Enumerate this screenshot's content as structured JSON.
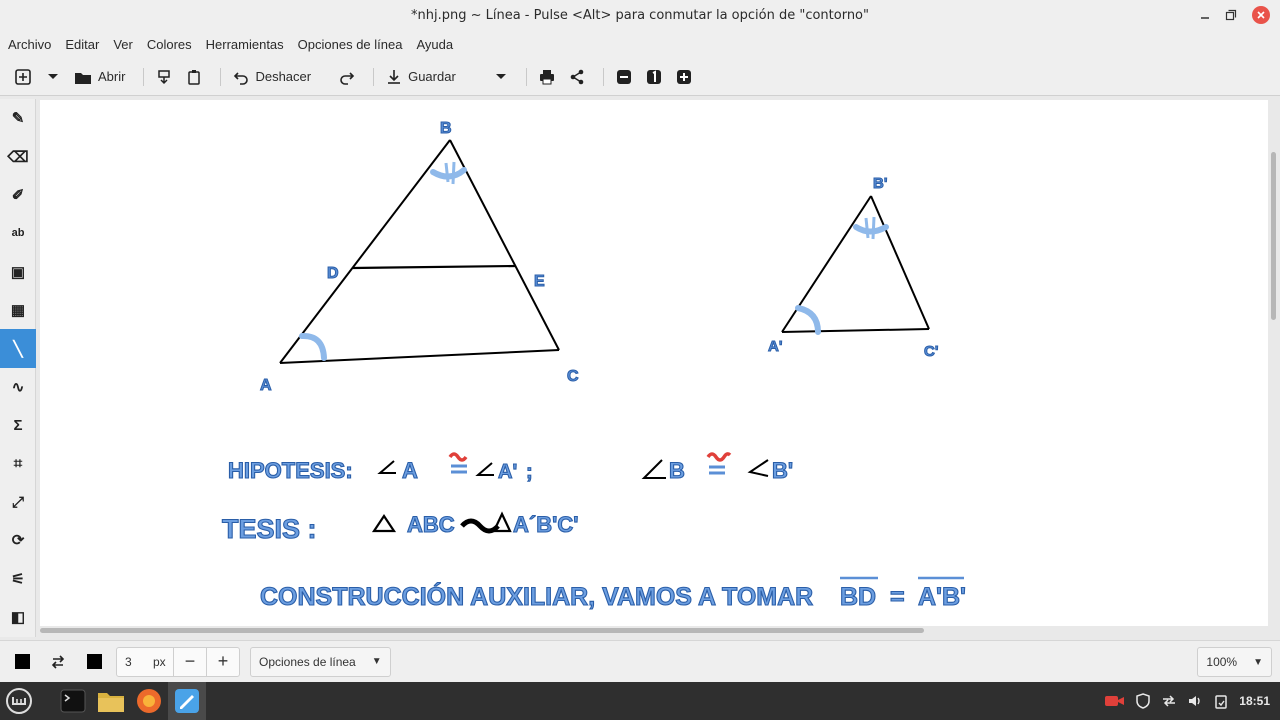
{
  "window": {
    "title": "*nhj.png ~ Línea - Pulse <Alt> para conmutar la opción de \"contorno\""
  },
  "menubar": {
    "items": [
      "Archivo",
      "Editar",
      "Ver",
      "Colores",
      "Herramientas",
      "Opciones de línea",
      "Ayuda"
    ]
  },
  "toolbar": {
    "open_label": "Abrir",
    "undo_label": "Deshacer",
    "save_label": "Guardar"
  },
  "palette": {
    "tools": [
      {
        "name": "pencil-tool-icon",
        "glyph": "✎"
      },
      {
        "name": "eraser-tool-icon",
        "glyph": "⌫"
      },
      {
        "name": "brush-tool-icon",
        "glyph": "✐"
      },
      {
        "name": "text-tool-icon",
        "glyph": "ab"
      },
      {
        "name": "rectangle-tool-icon",
        "glyph": "▣"
      },
      {
        "name": "selection-tool-icon",
        "glyph": "▦"
      },
      {
        "name": "line-tool-icon",
        "glyph": "╲",
        "active": true
      },
      {
        "name": "curve-tool-icon",
        "glyph": "∿"
      },
      {
        "name": "freeshape-tool-icon",
        "glyph": "Σ"
      },
      {
        "name": "crop-tool-icon",
        "glyph": "⌗"
      },
      {
        "name": "scale-tool-icon",
        "glyph": "⤢"
      },
      {
        "name": "rotate-tool-icon",
        "glyph": "⟳"
      },
      {
        "name": "filters-tool-icon",
        "glyph": "⚟"
      },
      {
        "name": "colors-tool-icon",
        "glyph": "◧"
      }
    ]
  },
  "canvas": {
    "labels": {
      "B": "B",
      "D": "D",
      "E": "E",
      "A": "A",
      "C": "C",
      "Bp": "B'",
      "Ap": "A'",
      "Cp": "C'"
    },
    "hipotesis": {
      "title": "HIPOTESIS:",
      "a1": "A",
      "a2": "A'",
      "sep": ";",
      "b1": "B",
      "b2": "B'"
    },
    "tesis": {
      "title": "TESIS :",
      "t1": "ABC",
      "t2": "A´B'C'"
    },
    "construccion": {
      "text": "CONSTRUCCIÓN AUXILIAR, VAMOS A TOMAR",
      "seg1": "BD",
      "eq": "=",
      "seg2": "A'B'"
    },
    "colors": {
      "label_fill": "#5b8fd6",
      "label_stroke": "#2a5ea8",
      "angle_mark": "#8fb9ea",
      "congruence_red": "#e0403a"
    }
  },
  "options": {
    "size_value": "3",
    "size_unit": "px",
    "minus": "−",
    "plus": "+",
    "line_options_label": "Opciones de línea",
    "zoom_label": "100%"
  },
  "tray": {
    "time": "18:51"
  }
}
